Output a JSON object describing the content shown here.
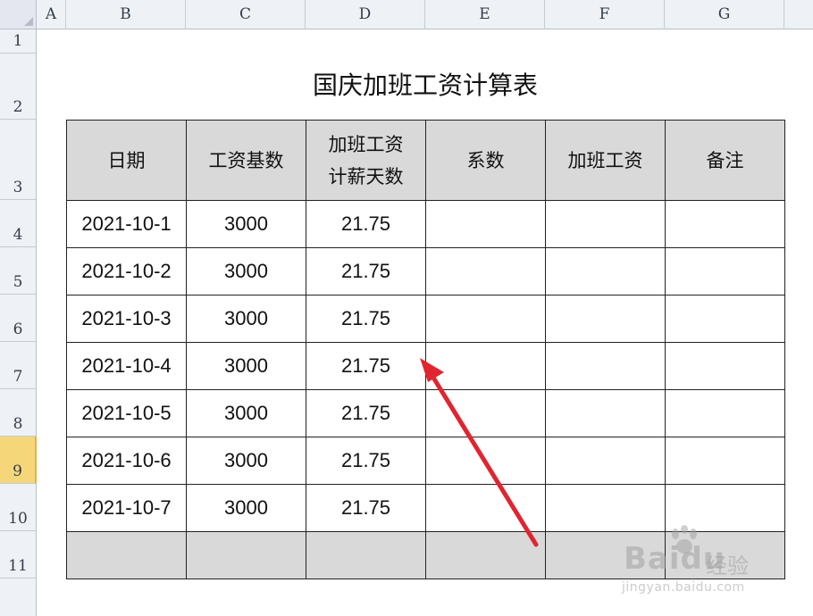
{
  "sheet": {
    "columns": [
      "A",
      "B",
      "C",
      "D",
      "E",
      "F",
      "G"
    ],
    "rows": [
      "1",
      "2",
      "3",
      "4",
      "5",
      "6",
      "7",
      "8",
      "9",
      "10",
      "11"
    ],
    "selected_row": "9"
  },
  "title": "国庆加班工资计算表",
  "table": {
    "headers": [
      {
        "line1": "日期",
        "line2": ""
      },
      {
        "line1": "工资基数",
        "line2": ""
      },
      {
        "line1": "加班工资",
        "line2": "计薪天数"
      },
      {
        "line1": "系数",
        "line2": ""
      },
      {
        "line1": "加班工资",
        "line2": ""
      },
      {
        "line1": "备注",
        "line2": ""
      }
    ],
    "rows": [
      [
        "2021-10-1",
        "3000",
        "21.75",
        "",
        "",
        ""
      ],
      [
        "2021-10-2",
        "3000",
        "21.75",
        "",
        "",
        ""
      ],
      [
        "2021-10-3",
        "3000",
        "21.75",
        "",
        "",
        ""
      ],
      [
        "2021-10-4",
        "3000",
        "21.75",
        "",
        "",
        ""
      ],
      [
        "2021-10-5",
        "3000",
        "21.75",
        "",
        "",
        ""
      ],
      [
        "2021-10-6",
        "3000",
        "21.75",
        "",
        "",
        ""
      ],
      [
        "2021-10-7",
        "3000",
        "21.75",
        "",
        "",
        ""
      ]
    ]
  },
  "annotation": {
    "arrow_color": "#e02530"
  },
  "watermark": {
    "brand": "Bai",
    "brand_suffix": "du",
    "cn": "经验",
    "url": "jingyan.baidu.com"
  }
}
